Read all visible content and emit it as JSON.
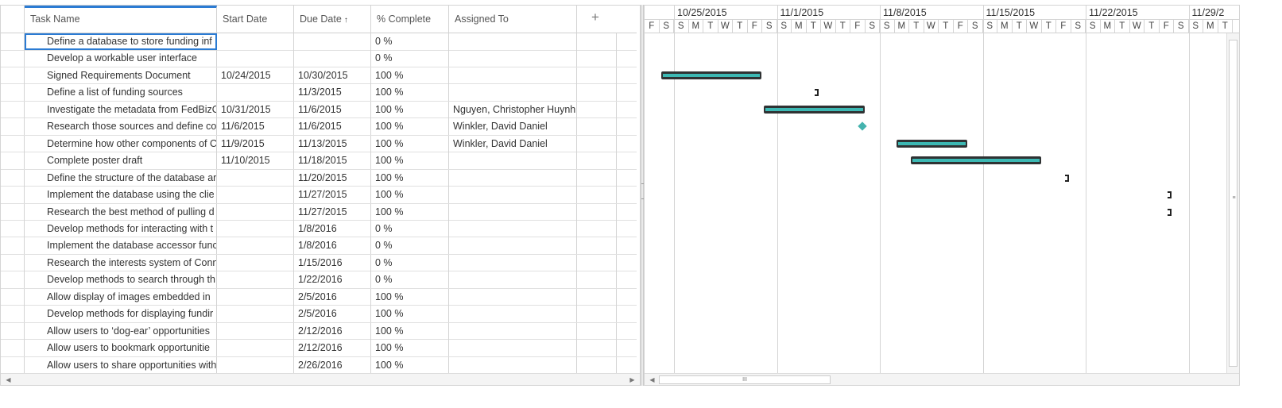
{
  "grid": {
    "columns": {
      "task": "Task Name",
      "start": "Start Date",
      "due": "Due Date",
      "pct": "% Complete",
      "assigned": "Assigned To"
    },
    "sort_indicator": "↑",
    "add_column": "+",
    "rows": [
      {
        "task": "Define a database to store funding inf",
        "start": "",
        "due": "",
        "pct": "0 %",
        "assigned": ""
      },
      {
        "task": "Develop a workable user interface",
        "start": "",
        "due": "",
        "pct": "0 %",
        "assigned": ""
      },
      {
        "task": "Signed Requirements Document",
        "start": "10/24/2015",
        "due": "10/30/2015",
        "pct": "100 %",
        "assigned": ""
      },
      {
        "task": "Define a list of funding sources",
        "start": "",
        "due": "11/3/2015",
        "pct": "100 %",
        "assigned": ""
      },
      {
        "task": "Investigate the metadata from FedBizO",
        "start": "10/31/2015",
        "due": "11/6/2015",
        "pct": "100 %",
        "assigned": "Nguyen, Christopher Huynh"
      },
      {
        "task": "Research those sources and define cor",
        "start": "11/6/2015",
        "due": "11/6/2015",
        "pct": "100 %",
        "assigned": "Winkler, David Daniel"
      },
      {
        "task": "Determine how other components of C",
        "start": "11/9/2015",
        "due": "11/13/2015",
        "pct": "100 %",
        "assigned": "Winkler, David Daniel"
      },
      {
        "task": "Complete poster draft",
        "start": "11/10/2015",
        "due": "11/18/2015",
        "pct": "100 %",
        "assigned": ""
      },
      {
        "task": "Define the structure of the database ar",
        "start": "",
        "due": "11/20/2015",
        "pct": "100 %",
        "assigned": ""
      },
      {
        "task": "Implement the database using the clie",
        "start": "",
        "due": "11/27/2015",
        "pct": "100 %",
        "assigned": ""
      },
      {
        "task": "Research the best method of pulling d",
        "start": "",
        "due": "11/27/2015",
        "pct": "100 %",
        "assigned": ""
      },
      {
        "task": "Develop methods for interacting with t",
        "start": "",
        "due": "1/8/2016",
        "pct": "0 %",
        "assigned": ""
      },
      {
        "task": "Implement the database accessor func",
        "start": "",
        "due": "1/8/2016",
        "pct": "0 %",
        "assigned": ""
      },
      {
        "task": "Research the interests system of Conn",
        "start": "",
        "due": "1/15/2016",
        "pct": "0 %",
        "assigned": ""
      },
      {
        "task": "Develop methods to search through th",
        "start": "",
        "due": "1/22/2016",
        "pct": "0 %",
        "assigned": ""
      },
      {
        "task": "Allow display of images embedded in",
        "start": "",
        "due": "2/5/2016",
        "pct": "100 %",
        "assigned": ""
      },
      {
        "task": "Develop methods for displaying fundir",
        "start": "",
        "due": "2/5/2016",
        "pct": "100 %",
        "assigned": ""
      },
      {
        "task": "Allow users to ‘dog-ear’ opportunities",
        "start": "",
        "due": "2/12/2016",
        "pct": "100 %",
        "assigned": ""
      },
      {
        "task": "Allow users to bookmark opportunitie",
        "start": "",
        "due": "2/12/2016",
        "pct": "100 %",
        "assigned": ""
      },
      {
        "task": "Allow users to share opportunities with",
        "start": "",
        "due": "2/26/2016",
        "pct": "100 %",
        "assigned": ""
      }
    ]
  },
  "gantt": {
    "weeks": [
      "10/25/2015",
      "11/1/2015",
      "11/8/2015",
      "11/15/2015",
      "11/22/2015",
      "11/29/2"
    ],
    "days": [
      "F",
      "S",
      "S",
      "M",
      "T",
      "W",
      "T",
      "F",
      "S",
      "S",
      "M",
      "T",
      "W",
      "T",
      "F",
      "S",
      "S",
      "M",
      "T",
      "W",
      "T",
      "F",
      "S",
      "S",
      "M",
      "T",
      "W",
      "T",
      "F",
      "S",
      "S",
      "M",
      "T",
      "W",
      "T",
      "F",
      "S",
      "S",
      "M",
      "T"
    ],
    "bar_color": "#2f3233",
    "progress_color": "#3cb8b3",
    "milestone_color": "#44b3ae"
  },
  "icons": {
    "scroll_left": "◀",
    "scroll_right": "▶",
    "grip_vertical": "≡",
    "grip_horizontal": "III"
  }
}
